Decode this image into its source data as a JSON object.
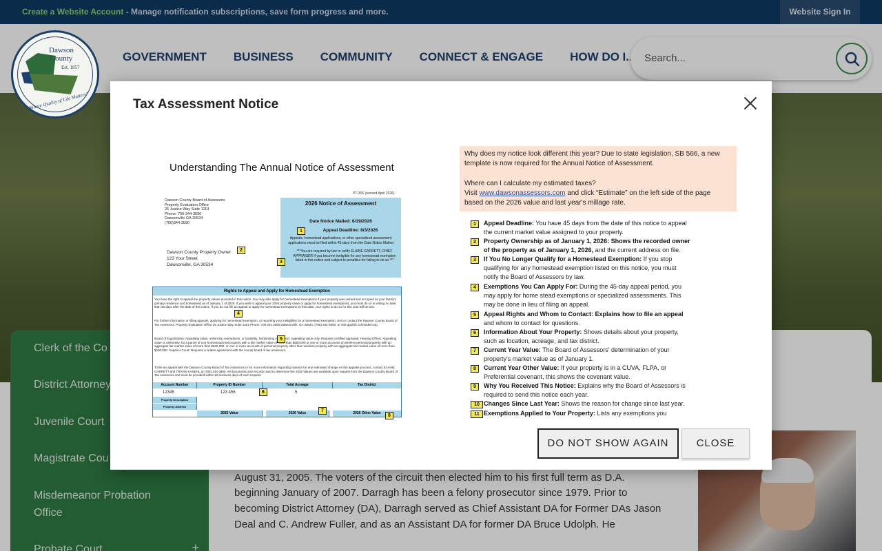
{
  "topbar": {
    "create_account_link": "Create a Website Account",
    "message": " - Manage notification subscriptions, save form progress and more.",
    "sign_in": "Website Sign In"
  },
  "logo": {
    "line1": "Dawson",
    "line2": "County",
    "est": "Est. 1857",
    "motto": "\"Where Quality of Life Matters\""
  },
  "nav": {
    "items": [
      "GOVERNMENT",
      "BUSINESS",
      "COMMUNITY",
      "CONNECT & ENGAGE",
      "HOW DO I..."
    ]
  },
  "search": {
    "placeholder": "Search..."
  },
  "sidenav": {
    "items": [
      "Clerk of the Co",
      "District Attorney",
      "Juvenile Court",
      "Magistrate Cou",
      "Misdemeanor Probation Office",
      "Probate Court"
    ],
    "expand_symbol": "+"
  },
  "content": {
    "paragraph": "the Northeastern Judicial Circuit - Hall County and Dawson County - and took office on August 31, 2005. The voters of the circuit then elected him to his first full term as D.A. beginning January of 2007. Darragh has been a felony prosecutor since 1979. Prior to becoming District Attorney (DA), Darragh served as Chief Assistant DA for Former DAs Jason Deal and C. Andrew Fuller, and as an Assistant DA for former DA Bruce Udolph. He"
  },
  "modal": {
    "title": "Tax Assessment Notice",
    "do_not_show_label": "DO NOT SHOW AGAIN",
    "close_label": "CLOSE",
    "notice": {
      "heading": "Understanding The Annual Notice of Assessment",
      "form_number": "PT-306 (revised April 2026)",
      "office_address": "Dawson County Board of Assessors\nProperty Evaluation Office\n25 Justice Way Suite 1201\nPhone: 706-344-3590\nDawsonville GA 30534\n(706)344-3590",
      "owner_address": "Dawson County Property Owner\n123 Your Street\nDawsonville, GA 30534",
      "box_title": "2026 Notice of Assessment",
      "date_mailed": "Date Notice Mailed: 6/19/2026",
      "appeal_deadline": "Appeal Deadline: 8/3/2026",
      "box_text": "Appeals, homestead applications, or other specialized assessment applications must be filed within 45 days from the Date Notice Mailed",
      "box_warning": "***You are required by law to notify ELAINE GARRETT, CHIEF APPRAISER if you become ineligible for any homestead exemption listed in this notice and subject to penalties for failing to do so.***",
      "rights_title": "Rights to Appeal and Apply for Homestead Exemption",
      "rights_text_1": "You have the right to appeal the property values provided in this notice. You may also apply for homestead exemptions if your property was owned and occupied as your family's primary residence and homestead as of January 1 of 2026. If you wish to appeal your 2026 property value or apply for homestead exemptions, you must do so in writing no later than 45 days after the date of this notice. If you do not file an appeal or apply for homestead exemptions by this date, your rights to do so for this year will be lost.",
      "rights_text_2": "For further information on filing appeals, applying for homestead exemption, or reporting your ineligibility for a homestead exemption, visit or contact the Dawson County Board of Tax Assessors: Property Evaluation Office 25 Justice Way Suite 1201 Phone: 706 344 3590 Dawsonville, GA 30534, (706) 344-3590, or visit qpublic.schneidercorp.",
      "rights_text_3": "Board of Equalization: Appealing value, uniformity, exemptions, or taxability. Nonbinding Arbitration: Appealing value only. Requires certified appraisal. Hearing Officer: Appealing value or uniformity, for a parcel of non-homestead real property with a fair market value of more than $500,000 or one or more accounts of wireless personal property with an aggregate fair market value of more than $500,000, or one or more accounts of personal property other than wireless property with an aggregate fair market value of more than $200,000. Superior Court: Requires a written agreement with the county board of tax assessors.",
      "rights_text_4": "To file an appeal with the Dawson County Board of Tax Assessors or for more information regarding reasons for any estimated change on the appeals process, contact ELAINE GARRETT and TRAVIS KANEHL at (706) 344-3590. All documents and records used to determine the 2026 Values are available upon request from the Dawson County Board of Tax Assessors and must be provided within 10 business days of such request.",
      "grid_headers": [
        "Account Number",
        "Property ID Number",
        "Total Acreage",
        "Tax District"
      ],
      "grid_values": [
        "12345",
        "123 456",
        "5",
        ""
      ],
      "grid_row_labels": [
        "Property Description",
        "Property Address"
      ],
      "grid_value_headers": [
        "2025 Value",
        "2026 Value",
        "2026 Other Value"
      ]
    },
    "explain": {
      "q1": "Why does my notice look different this year? Due to state legislation, SB 566, a new template is now required for the Annual Notice of Assessment.",
      "q2": "Where can I calculate my estimated taxes?",
      "q2_visit": "Visit ",
      "q2_link": "www.dawsonassessors.com",
      "q2_rest": " and click “Estimate” on the left side of the page based on the 2026 value and last year's millage rate.",
      "items": [
        {
          "num": "1",
          "title": "Appeal Deadline:",
          "text": " You have 45 days from the date of this notice to appeal the current market value assigned to your property."
        },
        {
          "num": "2",
          "title": "Property Ownership as of January 1, 2026: Shows the recorded owner of the property as of January 1, 2026,",
          "text": " and the current address on file."
        },
        {
          "num": "3",
          "title": "If You No Longer Qualify for a Homestead Exemption:",
          "text": " If you stop qualifying for any homestead exemption listed on this notice, you must notify the Board of Assessors by law."
        },
        {
          "num": "4",
          "title": "Exemptions You Can Apply For:",
          "text": " During the 45-day appeal period, you may apply for home stead exemptions or specialized assessments. This may be done in lieu of filing an appeal."
        },
        {
          "num": "5",
          "title": "Appeal Rights and Whom to Contact: Explains how to file an appeal",
          "text": " and whom to contact for questions."
        },
        {
          "num": "6",
          "title": "Information About Your Property:",
          "text": " Shows details about your property, such as location, acreage, and tax district."
        },
        {
          "num": "7",
          "title": "Current Year Value:",
          "text": " The Board of Assessors' determination of your property's market value as of January 1."
        },
        {
          "num": "8",
          "title": "Current Year Other Value:",
          "text": " If your property is in a CUVA, FLPA, or Preferential covenant, this shows the covenant value."
        },
        {
          "num": "9",
          "title": "Why You Received This Notice:",
          "text": " Explains why the Board of Assessors is required to send this notice each year."
        },
        {
          "num": "10",
          "title": "Changes Since Last Year:",
          "text": " Shows the reason for change since last year."
        },
        {
          "num": "11",
          "title": "Exemptions Applied to Your Property:",
          "text": " Lists any exemptions you"
        }
      ]
    }
  }
}
